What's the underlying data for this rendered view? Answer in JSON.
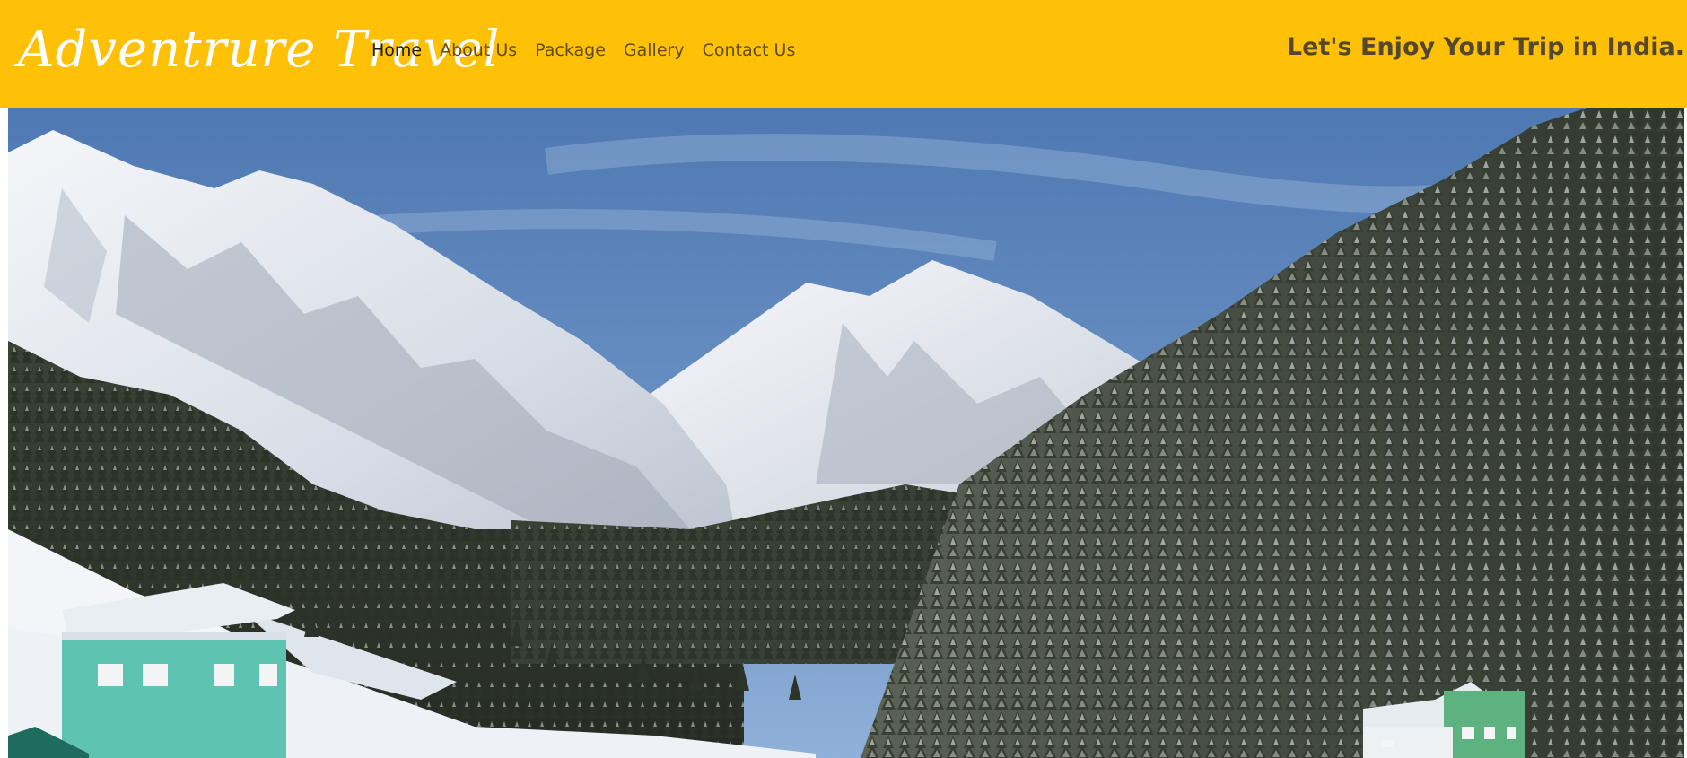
{
  "navbar": {
    "brand": "Adventrure Travel",
    "links": [
      {
        "label": "Home",
        "active": true
      },
      {
        "label": "About Us",
        "active": false
      },
      {
        "label": "Package",
        "active": false
      },
      {
        "label": "Gallery",
        "active": false
      },
      {
        "label": "Contact Us",
        "active": false
      }
    ],
    "tagline": "Let's Enjoy Your Trip in India."
  },
  "colors": {
    "navbar_bg": "#ffc107",
    "brand_text": "#ffffff",
    "nav_link": "#5f4d17",
    "nav_link_active": "#1a1a1a",
    "tagline_text": "#55472a"
  },
  "hero": {
    "scene": "snow-mountain-valley-photo"
  }
}
